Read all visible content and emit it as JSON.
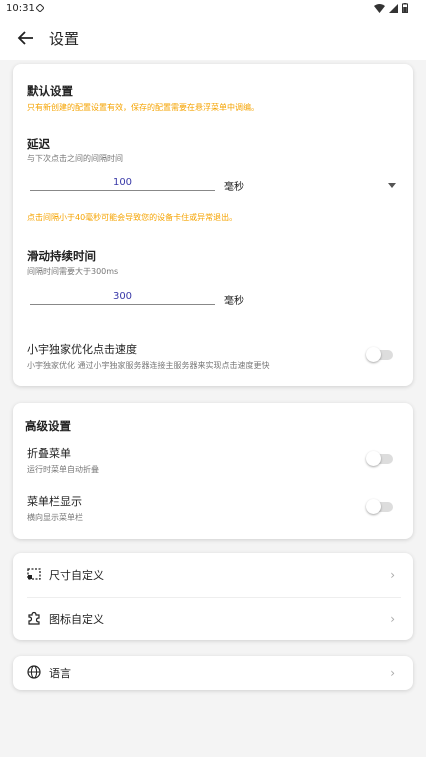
{
  "status_bar": {
    "time": "10:31"
  },
  "header": {
    "title": "设置"
  },
  "default_settings": {
    "title": "默认设置",
    "note": "只有新创建的配置设置有效，保存的配置需要在悬浮菜单中调编。",
    "delay": {
      "label": "延迟",
      "desc": "与下次点击之间的间隔时间",
      "value": "100",
      "unit": "毫秒",
      "warning": "点击间隔小于40毫秒可能会导致您的设备卡住或异常退出。"
    },
    "swipe": {
      "label": "滑动持续时间",
      "desc": "间隔时间需要大于300ms",
      "value": "300",
      "unit": "毫秒"
    },
    "optimize": {
      "label": "小宇独家优化点击速度",
      "desc": "小宇独家优化  通过小宇独家服务器连接主服务器来实现点击速度更快",
      "enabled": false
    }
  },
  "advanced": {
    "title": "高级设置",
    "fold_menu": {
      "label": "折叠菜单",
      "desc": "运行时菜单自动折叠",
      "enabled": false
    },
    "menubar": {
      "label": "菜单栏显示",
      "desc": "横向显示菜单栏",
      "enabled": false
    }
  },
  "customize": [
    {
      "label": "尺寸自定义",
      "icon": "size-frame-icon"
    },
    {
      "label": "图标自定义",
      "icon": "puzzle-icon"
    }
  ],
  "language": {
    "label": "语言",
    "icon": "globe-icon"
  },
  "colors": {
    "accent": "#f5a300",
    "input_text": "#3a3aa8"
  }
}
